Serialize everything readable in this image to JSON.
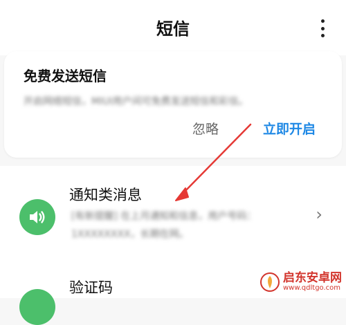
{
  "header": {
    "title": "短信"
  },
  "promo": {
    "title": "免费发送短信",
    "description": "开启网络短信，MIUI用户间可免费发送短信和彩信。",
    "ignore_label": "忽略",
    "enable_label": "立即开启"
  },
  "list": [
    {
      "title": "通知类消息",
      "subtitle": "[有新提醒] 在上月通知和信息，用户号码：1XXXXXXXX，长期在网。",
      "icon": "speaker-icon"
    },
    {
      "title": "验证码",
      "icon": "green-circle-icon"
    }
  ],
  "watermark": {
    "main": "启东安卓网",
    "url": "www.qdltgo.com"
  },
  "colors": {
    "accent": "#1e88e5",
    "icon_green": "#4cbf6b",
    "annotation_red": "#e53935",
    "watermark_red": "#d2342c"
  }
}
